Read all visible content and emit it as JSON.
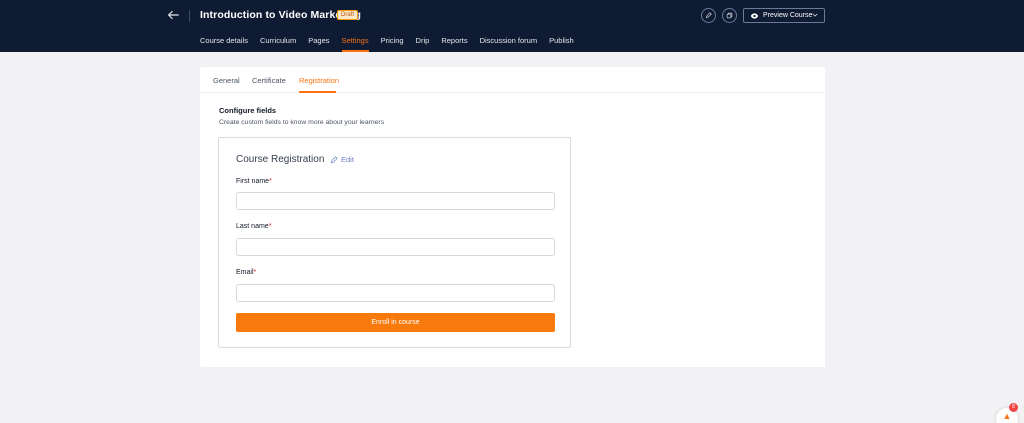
{
  "header": {
    "back_icon": "arrow-left-icon",
    "title": "Introduction to Video Marketing",
    "status_badge": "Draft",
    "preview_label": "Preview Course",
    "nav": [
      {
        "label": "Course details"
      },
      {
        "label": "Curriculum"
      },
      {
        "label": "Pages"
      },
      {
        "label": "Settings",
        "active": true
      },
      {
        "label": "Pricing"
      },
      {
        "label": "Drip"
      },
      {
        "label": "Reports"
      },
      {
        "label": "Discussion forum"
      },
      {
        "label": "Publish"
      }
    ]
  },
  "settings": {
    "tabs": [
      {
        "label": "General"
      },
      {
        "label": "Certificate"
      },
      {
        "label": "Registration",
        "active": true
      }
    ],
    "section_title": "Configure fields",
    "section_subtitle": "Create custom fields to know more about your learners",
    "form": {
      "title": "Course Registration",
      "edit_label": "Edit",
      "fields": [
        {
          "label": "First name",
          "required": "*",
          "value": ""
        },
        {
          "label": "Last name",
          "required": "*",
          "value": ""
        },
        {
          "label": "Email",
          "required": "*",
          "value": ""
        }
      ],
      "submit_label": "Enroll in course"
    }
  },
  "widget": {
    "notification_count": "8",
    "icon": "megaphone-icon"
  },
  "colors": {
    "header_bg": "#0f1b33",
    "accent": "#f97316",
    "button": "#f97a0c",
    "page_bg": "#f2f2f4"
  }
}
